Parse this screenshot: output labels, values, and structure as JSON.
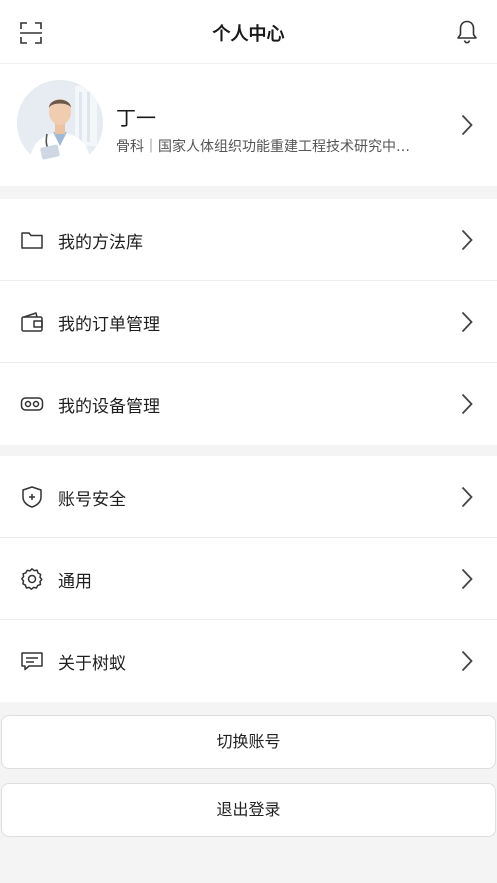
{
  "header": {
    "title": "个人中心",
    "left_icon": "scan-icon",
    "right_icon": "bell-icon"
  },
  "profile": {
    "name": "丁一",
    "description": "骨科｜国家人体组织功能重建工程技术研究中…",
    "avatar": "doctor-avatar"
  },
  "menu_group_1": [
    {
      "label": "我的方法库",
      "icon": "folder-icon"
    },
    {
      "label": "我的订单管理",
      "icon": "wallet-icon"
    },
    {
      "label": "我的设备管理",
      "icon": "vr-headset-icon"
    }
  ],
  "menu_group_2": [
    {
      "label": "账号安全",
      "icon": "shield-plus-icon"
    },
    {
      "label": "通用",
      "icon": "gear-icon"
    },
    {
      "label": "关于树蚁",
      "icon": "message-icon"
    }
  ],
  "buttons": {
    "switch_account": "切换账号",
    "logout": "退出登录"
  },
  "colors": {
    "background": "#f4f4f5",
    "card": "#ffffff",
    "text": "#1f1f1f",
    "icon_stroke": "#333333"
  }
}
